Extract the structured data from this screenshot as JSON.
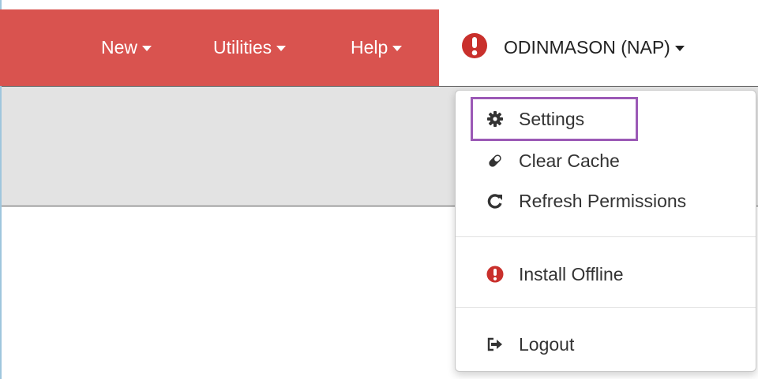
{
  "navbar": {
    "items": [
      {
        "label": "New"
      },
      {
        "label": "Utilities"
      },
      {
        "label": "Help"
      }
    ],
    "user": {
      "label": "ODINMASON (NAP)"
    },
    "color": "#d9534f"
  },
  "dropdown": {
    "items": [
      {
        "label": "Settings",
        "icon": "gear-icon"
      },
      {
        "label": "Clear Cache",
        "icon": "eraser-icon"
      },
      {
        "label": "Refresh Permissions",
        "icon": "refresh-icon"
      },
      {
        "label": "Install Offline",
        "icon": "exclamation-circle-icon"
      },
      {
        "label": "Logout",
        "icon": "logout-icon"
      }
    ],
    "highlighted_item": "Settings",
    "highlight_color": "#9b59b6"
  },
  "colors": {
    "alert": "#d9534f",
    "subbar": "#e3e3e3"
  }
}
